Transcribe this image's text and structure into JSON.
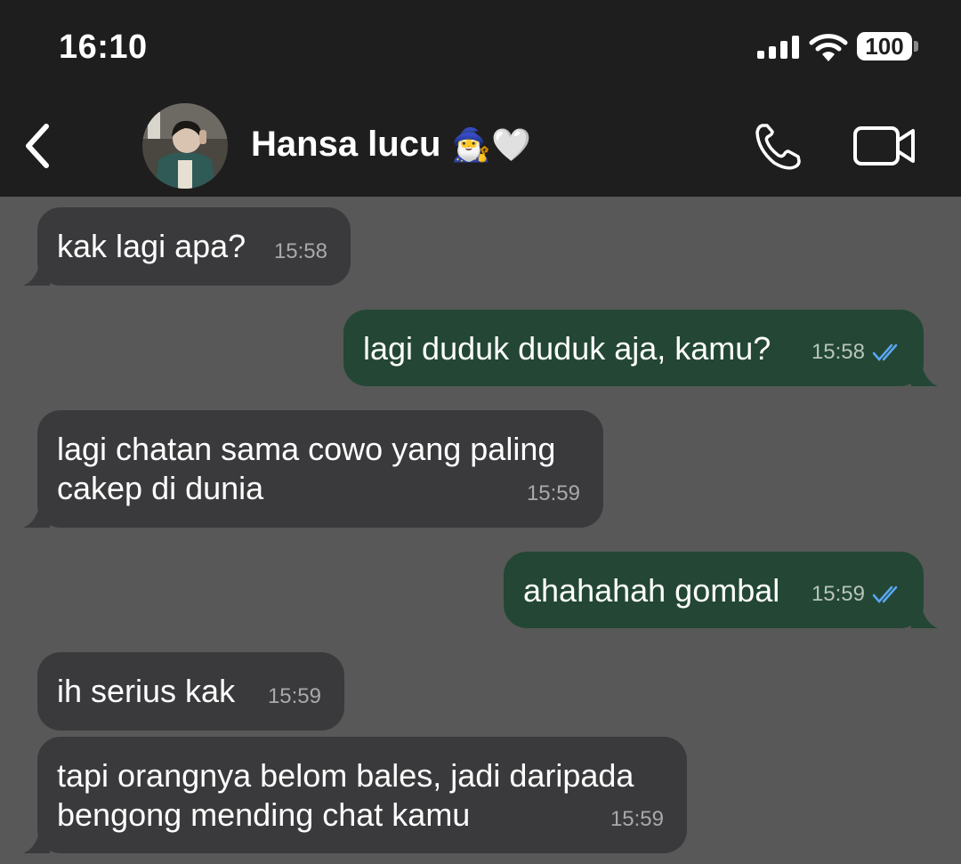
{
  "status_bar": {
    "time": "16:10",
    "battery": "100",
    "icons": [
      "signal-icon",
      "wifi-icon",
      "battery-icon"
    ]
  },
  "header": {
    "contact_name": "Hansa lucu",
    "contact_emoji": "🧙‍♂️🤍",
    "icons": [
      "back-chevron-icon",
      "avatar",
      "phone-icon",
      "video-camera-icon"
    ]
  },
  "colors": {
    "chat_background": "#585858",
    "header_background": "#1e1e1e",
    "incoming_bubble": "#3a3a3c",
    "outgoing_bubble": "#234734",
    "read_ticks": "#5aa7f5"
  },
  "messages": [
    {
      "direction": "in",
      "text": "kak lagi apa?",
      "time": "15:58"
    },
    {
      "direction": "out",
      "text": "lagi duduk duduk aja, kamu?",
      "time": "15:58",
      "status": "read"
    },
    {
      "direction": "in",
      "text": "lagi chatan sama cowo yang paling cakep di dunia",
      "time": "15:59"
    },
    {
      "direction": "out",
      "text": "ahahahah gombal",
      "time": "15:59",
      "status": "read"
    },
    {
      "direction": "in",
      "text": "ih serius kak",
      "time": "15:59"
    },
    {
      "direction": "in",
      "text": "tapi orangnya belom bales, jadi daripada bengong mending chat kamu",
      "time": "15:59"
    }
  ]
}
